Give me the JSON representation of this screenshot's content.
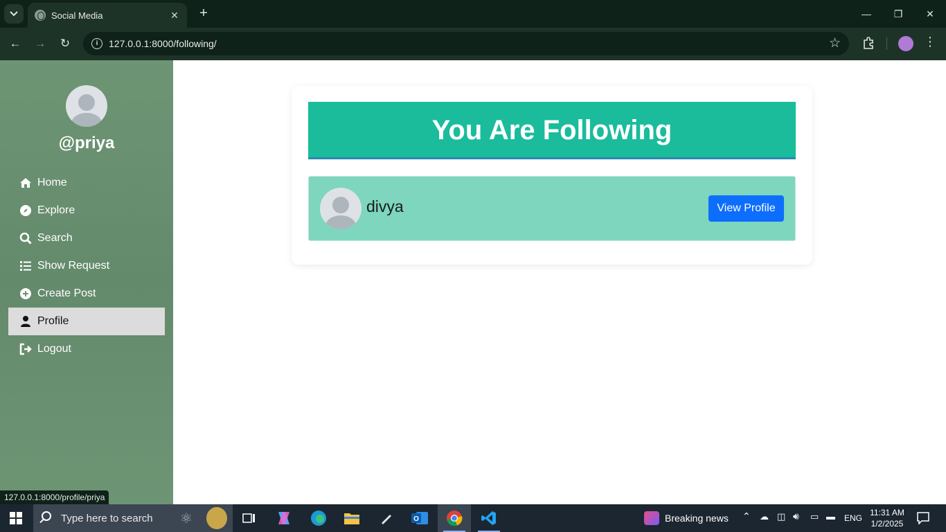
{
  "browser": {
    "tab_title": "Social Media",
    "url": "127.0.0.1:8000/following/",
    "status_url": "127.0.0.1:8000/profile/priya"
  },
  "sidebar": {
    "username": "@priya",
    "items": [
      {
        "label": "Home",
        "icon": "home-icon"
      },
      {
        "label": "Explore",
        "icon": "compass-icon"
      },
      {
        "label": "Search",
        "icon": "search-icon"
      },
      {
        "label": "Show Request",
        "icon": "list-icon"
      },
      {
        "label": "Create Post",
        "icon": "plus-circle-icon"
      },
      {
        "label": "Profile",
        "icon": "user-icon",
        "active": true
      },
      {
        "label": "Logout",
        "icon": "logout-icon"
      }
    ]
  },
  "main": {
    "title": "You Are Following",
    "following": [
      {
        "name": "divya",
        "button_label": "View Profile"
      }
    ]
  },
  "taskbar": {
    "search_placeholder": "Type here to search",
    "news": "Breaking news",
    "language": "ENG",
    "time": "11:31 AM",
    "date": "1/2/2025"
  },
  "colors": {
    "sidebar": "#6b9272",
    "banner": "#1abc9c",
    "row": "#7dd6bd",
    "button": "#0d6efd"
  }
}
